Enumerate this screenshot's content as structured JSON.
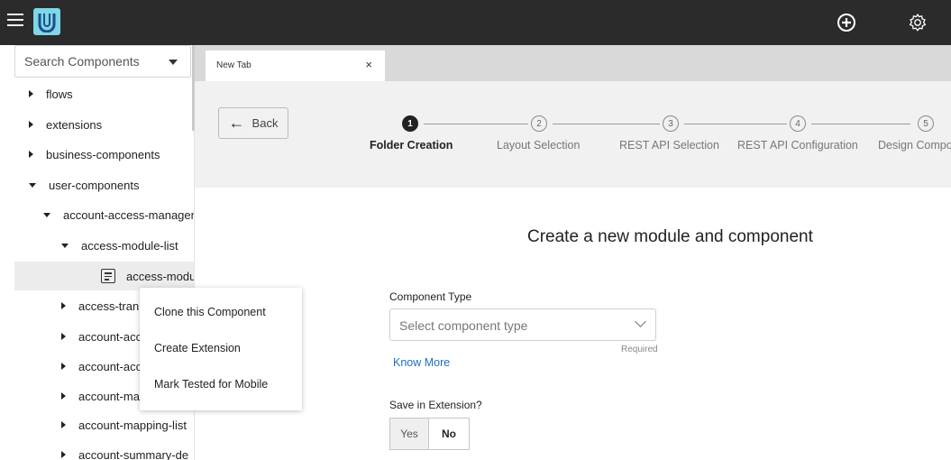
{
  "sidebar": {
    "search_placeholder": "Search Components",
    "tree": [
      {
        "label": "flows",
        "expanded": false
      },
      {
        "label": "extensions",
        "expanded": false
      },
      {
        "label": "business-components",
        "expanded": false
      },
      {
        "label": "user-components",
        "expanded": true
      },
      {
        "label": "account-access-managen",
        "expanded": true
      },
      {
        "label": "access-module-list",
        "expanded": true
      },
      {
        "label": "access-modu",
        "selected": true
      },
      {
        "label": "access-tran",
        "expanded": false
      },
      {
        "label": "account-acc",
        "expanded": false
      },
      {
        "label": "account-acc",
        "expanded": false
      },
      {
        "label": "account-ma",
        "expanded": false
      },
      {
        "label": "account-mapping-list",
        "expanded": false
      },
      {
        "label": "account-summary-de",
        "expanded": false
      }
    ]
  },
  "tab": {
    "label": "New Tab",
    "close": "×"
  },
  "wizard": {
    "back_label": "Back",
    "steps": [
      {
        "number": "1",
        "label": "Folder Creation",
        "active": true
      },
      {
        "number": "2",
        "label": "Layout Selection",
        "active": false
      },
      {
        "number": "3",
        "label": "REST API Selection",
        "active": false
      },
      {
        "number": "4",
        "label": "REST API Configuration",
        "active": false
      },
      {
        "number": "5",
        "label": "Design Compo",
        "active": false
      }
    ]
  },
  "main": {
    "title": "Create a new module and component",
    "component_type_label": "Component Type",
    "component_type_placeholder": "Select component type",
    "required_text": "Required",
    "know_more": "Know More",
    "save_in_extension_label": "Save in Extension?",
    "yes_label": "Yes",
    "no_label": "No"
  },
  "context_menu": {
    "items": [
      "Clone this Component",
      "Create Extension",
      "Mark Tested for Mobile"
    ]
  },
  "colors": {
    "topbar": "#2b2b2b",
    "logo": "#7fd6e6",
    "link": "#1f6fbd",
    "wizard_bg": "#f1f1f1"
  },
  "icons": {
    "menu": "hamburger-icon",
    "add": "plus-circle-icon",
    "settings": "gear-icon"
  }
}
